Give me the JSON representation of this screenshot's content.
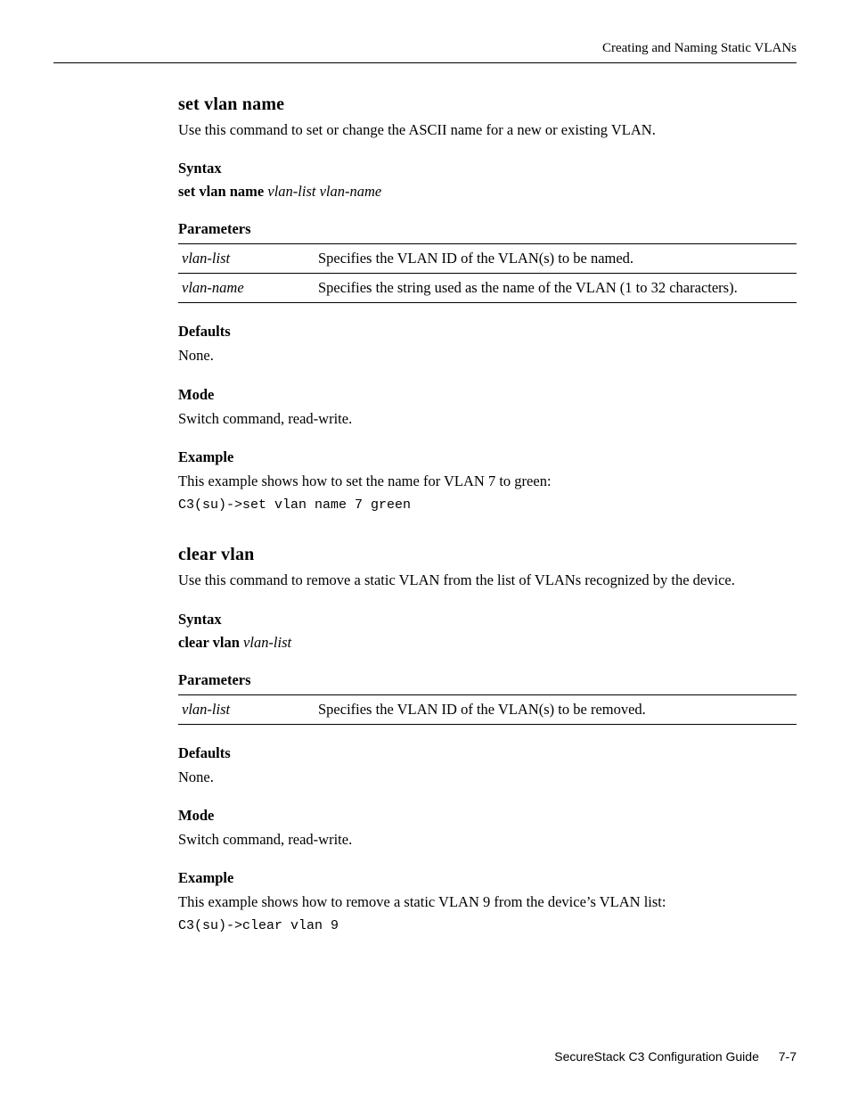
{
  "header": {
    "right": "Creating and Naming Static VLANs"
  },
  "cmd1": {
    "title": "set vlan name",
    "desc": "Use this command to set or change the ASCII name for a new or existing VLAN.",
    "syntax_h": "Syntax",
    "syntax_kw": "set vlan name",
    "syntax_a1": "vlan-list",
    "syntax_a2": "vlan-name",
    "params_h": "Parameters",
    "params": [
      {
        "name": "vlan-list",
        "desc": "Specifies the VLAN ID of the VLAN(s) to be named."
      },
      {
        "name": "vlan-name",
        "desc": "Specifies the string used as the name of the VLAN (1 to 32 characters)."
      }
    ],
    "defaults_h": "Defaults",
    "defaults": "None.",
    "mode_h": "Mode",
    "mode": "Switch command, read-write.",
    "example_h": "Example",
    "example_lead": "This example shows how to set the name for VLAN 7 to green:",
    "example_code": "C3(su)->set vlan name 7 green"
  },
  "cmd2": {
    "title": "clear vlan",
    "desc": "Use this command to remove a static VLAN from the list of VLANs recognized by the device.",
    "syntax_h": "Syntax",
    "syntax_kw": "clear vlan",
    "syntax_a1": "vlan-list",
    "params_h": "Parameters",
    "params": [
      {
        "name": "vlan-list",
        "desc": "Specifies the VLAN ID of the VLAN(s) to be removed."
      }
    ],
    "defaults_h": "Defaults",
    "defaults": "None.",
    "mode_h": "Mode",
    "mode": "Switch command, read-write.",
    "example_h": "Example",
    "example_lead": "This example shows how to remove a static VLAN 9 from the device’s VLAN list:",
    "example_code": "C3(su)->clear vlan 9"
  },
  "footer": {
    "text": "SecureStack C3 Configuration Guide",
    "page": "7-7"
  }
}
